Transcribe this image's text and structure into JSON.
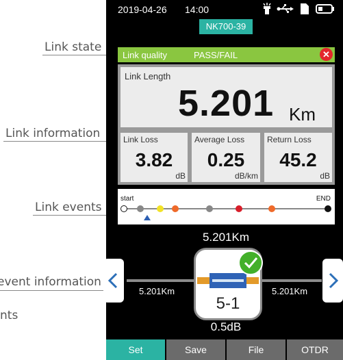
{
  "annotations": {
    "link_state": "Link state",
    "link_information": "Link information",
    "link_events": "Link events",
    "event_information": "event information",
    "partial": "nts"
  },
  "status": {
    "date": "2019-04-26",
    "time": "14:00"
  },
  "device_name": "NK700-39",
  "link_state": {
    "label": "Link quality",
    "result": "PASS/FAIL",
    "close_symbol": "✕",
    "fail_color": "#e4262c",
    "bar_color": "#8ac640"
  },
  "link_length": {
    "title": "Link Length",
    "value": "5.201",
    "unit": "Km"
  },
  "losses": [
    {
      "title": "Link Loss",
      "value": "3.82",
      "unit": "dB"
    },
    {
      "title": "Average Loss",
      "value": "0.25",
      "unit": "dB/km"
    },
    {
      "title": "Return Loss",
      "value": "45.2",
      "unit": "dB"
    }
  ],
  "events": {
    "start_label": "start",
    "end_label": "END",
    "dots": [
      "hollow",
      "gray",
      "yellow",
      "orange",
      "gray",
      "red",
      "orange",
      "black"
    ],
    "selected_index": 1
  },
  "event_detail": {
    "distance": "5.201Km",
    "left_distance": "5.201Km",
    "right_distance": "5.201Km",
    "event_id": "5-1",
    "loss": "0.5dB",
    "status": "pass"
  },
  "bottom_tabs": [
    {
      "label": "Set",
      "active": true
    },
    {
      "label": "Save",
      "active": false
    },
    {
      "label": "File",
      "active": false
    },
    {
      "label": "OTDR",
      "active": false
    }
  ],
  "colors": {
    "accent": "#2bb3a3",
    "tab_inactive": "#6b6b6b"
  }
}
